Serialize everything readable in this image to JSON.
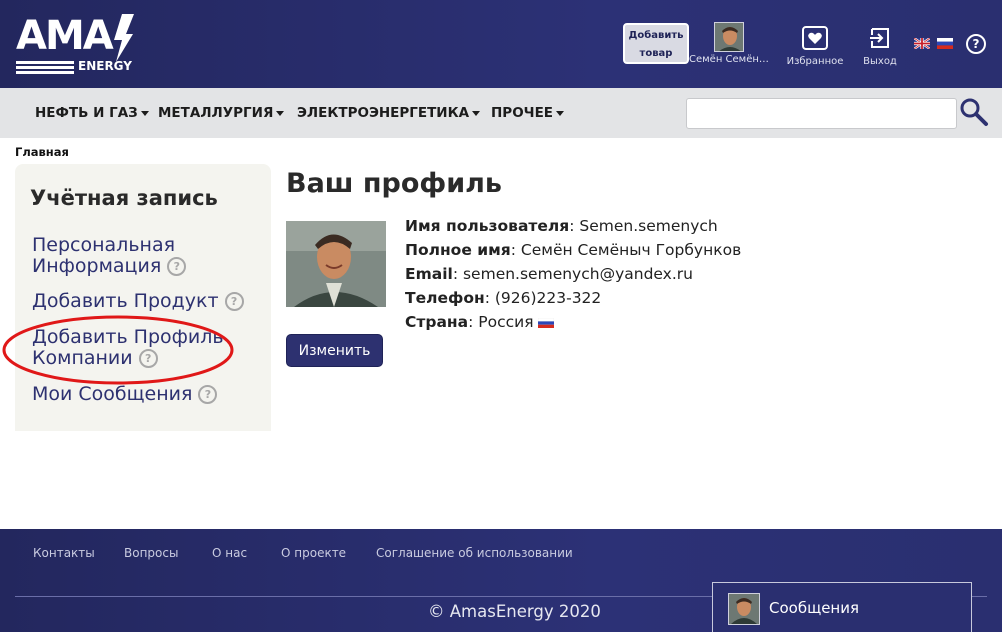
{
  "logo": {
    "main": "AMA",
    "sub": "ENERGY"
  },
  "header": {
    "add_product_label": "Добавить товар",
    "user_name": "Семён Семёны...",
    "favorites_label": "Избранное",
    "logout_label": "Выход",
    "help_label": "?"
  },
  "nav": {
    "items": [
      {
        "label": "НЕФТЬ И ГАЗ"
      },
      {
        "label": "МЕТАЛЛУРГИЯ"
      },
      {
        "label": "ЭЛЕКТРОЭНЕРГЕТИКА"
      },
      {
        "label": "ПРОЧЕЕ"
      }
    ],
    "search_value": ""
  },
  "breadcrumb": "Главная",
  "sidebar": {
    "title": "Учётная запись",
    "links": [
      {
        "label_line1": "Персональная",
        "label_line2": "Информация"
      },
      {
        "label": "Добавить Продукт"
      },
      {
        "label_line1": "Добавить Профиль",
        "label_line2": "Компании"
      },
      {
        "label": "Мои Сообщения"
      }
    ],
    "help_glyph": "?"
  },
  "profile": {
    "title": "Ваш профиль",
    "fields": [
      {
        "label": "Имя пользователя",
        "value": "Semen.semenych"
      },
      {
        "label": "Полное имя",
        "value": "Семён Семёныч Горбунков"
      },
      {
        "label": "Email",
        "value": "semen.semenych@yandex.ru"
      },
      {
        "label": "Телефон",
        "value": "(926)223-322"
      },
      {
        "label": "Страна",
        "value": "Россия"
      }
    ],
    "edit_label": "Изменить"
  },
  "footer": {
    "links": [
      {
        "label": "Контакты"
      },
      {
        "label": "Вопросы"
      },
      {
        "label": "О нас"
      },
      {
        "label": "О проекте"
      },
      {
        "label": "Соглашение об использовании"
      }
    ],
    "copyright": "© AmasEnergy 2020"
  },
  "messages_panel": {
    "label": "Сообщения"
  },
  "colors": {
    "header_bg": "#2a2f70",
    "nav_bg": "#e3e4e6",
    "link": "#2d3170",
    "annotation": "#e01818"
  },
  "icons": [
    "search-icon",
    "heart-icon",
    "logout-icon",
    "help-icon",
    "flag-uk-icon",
    "flag-ru-icon",
    "question-icon"
  ]
}
